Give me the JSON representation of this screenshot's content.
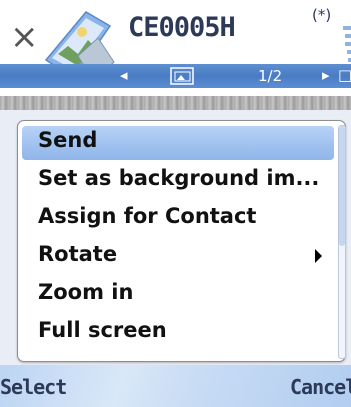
{
  "title_bar": {
    "title": "CE0005H",
    "bluetooth_indicator": "(*)",
    "close_glyph": "×",
    "app_icon": "gallery-image-icon"
  },
  "nav_bar": {
    "prev_glyph": "◂",
    "next_glyph": "▸",
    "page": "1/2",
    "media_icon": "image-icon"
  },
  "menu": {
    "items": [
      {
        "label": "Send",
        "highlighted": true
      },
      {
        "label": "Set as background im...",
        "highlighted": false
      },
      {
        "label": "Assign for Contact",
        "highlighted": false
      },
      {
        "label": "Rotate",
        "highlighted": false,
        "has_submenu": true
      },
      {
        "label": "Zoom in",
        "highlighted": false
      },
      {
        "label": "Full screen",
        "highlighted": false
      }
    ]
  },
  "softkeys": {
    "left": "Select",
    "right": "Cancel"
  },
  "colors": {
    "accent": "#4a7cc4",
    "highlight": "#a9c7f1",
    "title_text": "#2c3a58"
  }
}
